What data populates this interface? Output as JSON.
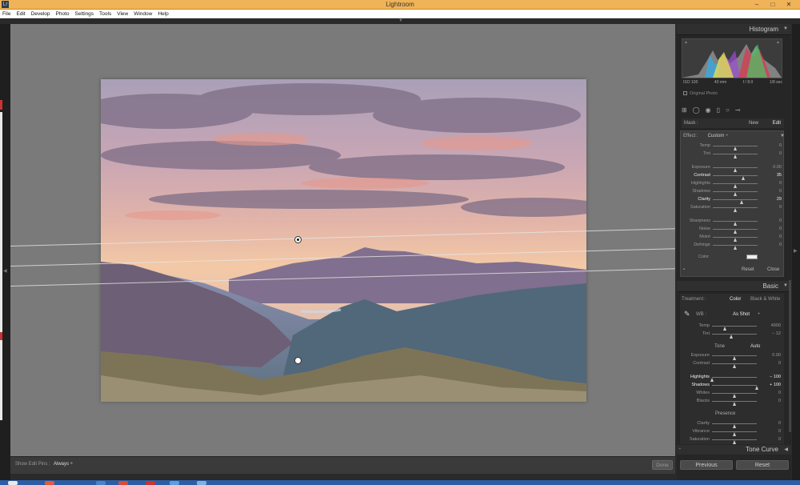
{
  "window": {
    "title": "Lightroom",
    "app_icon": "Lr",
    "controls": [
      "–",
      "□",
      "✕"
    ]
  },
  "menu": [
    "File",
    "Edit",
    "Develop",
    "Photo",
    "Settings",
    "Tools",
    "View",
    "Window",
    "Help"
  ],
  "histogram": {
    "title": "Histogram",
    "meta": {
      "iso": "ISO 100",
      "focal": "40 mm",
      "aperture": "f / 8.0",
      "shutter": "1/8 sec"
    },
    "original_photo_label": "Original Photo"
  },
  "mask": {
    "label": "Mask :",
    "new": "New",
    "edit": "Edit"
  },
  "effect": {
    "label": "Effect :",
    "preset": "Custom",
    "arrows": "÷",
    "sliders": [
      {
        "label": "Temp",
        "value": "0",
        "pos": 0.5
      },
      {
        "label": "Tint",
        "value": "0",
        "pos": 0.5
      },
      {
        "label": "Exposure",
        "value": "0.00",
        "pos": 0.5
      },
      {
        "label": "Contrast",
        "value": "35",
        "pos": 0.68,
        "hl": true
      },
      {
        "label": "Highlights",
        "value": "0",
        "pos": 0.5
      },
      {
        "label": "Shadows",
        "value": "0",
        "pos": 0.5
      },
      {
        "label": "Clarity",
        "value": "29",
        "pos": 0.65,
        "hl": true
      },
      {
        "label": "Saturation",
        "value": "0",
        "pos": 0.5
      },
      {
        "label": "Sharpness",
        "value": "0",
        "pos": 0.5
      },
      {
        "label": "Noise",
        "value": "0",
        "pos": 0.5
      },
      {
        "label": "Moiré",
        "value": "0",
        "pos": 0.5
      },
      {
        "label": "Defringe",
        "value": "0",
        "pos": 0.5
      }
    ],
    "color_label": "Color",
    "reset": "Reset",
    "close": "Close"
  },
  "basic": {
    "title": "Basic",
    "treatment_label": "Treatment :",
    "color": "Color",
    "bw": "Black & White",
    "wb_label": "WB :",
    "wb_value": "As Shot",
    "wb_arrows": "÷",
    "wb_sliders": [
      {
        "label": "Temp",
        "value": "4900",
        "pos": 0.3
      },
      {
        "label": "Tint",
        "value": "– 12",
        "pos": 0.43
      }
    ],
    "tone_label": "Tone",
    "auto": "Auto",
    "tone_sliders": [
      {
        "label": "Exposure",
        "value": "0.00",
        "pos": 0.5
      },
      {
        "label": "Contrast",
        "value": "0",
        "pos": 0.5
      }
    ],
    "tone_sliders2": [
      {
        "label": "Highlights",
        "value": "– 100",
        "pos": 0.0,
        "hl": true
      },
      {
        "label": "Shadows",
        "value": "+ 100",
        "pos": 1.0,
        "hl": true
      },
      {
        "label": "Whites",
        "value": "0",
        "pos": 0.5
      },
      {
        "label": "Blacks",
        "value": "0",
        "pos": 0.5
      }
    ],
    "presence_label": "Presence",
    "presence_sliders": [
      {
        "label": "Clarity",
        "value": "0",
        "pos": 0.5
      },
      {
        "label": "Vibrance",
        "value": "0",
        "pos": 0.5
      },
      {
        "label": "Saturation",
        "value": "0",
        "pos": 0.5
      }
    ]
  },
  "tone_curve": {
    "title": "Tone Curve"
  },
  "buttons": {
    "previous": "Previous",
    "reset": "Reset"
  },
  "toolbar": {
    "show_edit_pins_label": "Show Edit Pins :",
    "show_edit_pins_value": "Always  ÷",
    "done": "Done"
  }
}
